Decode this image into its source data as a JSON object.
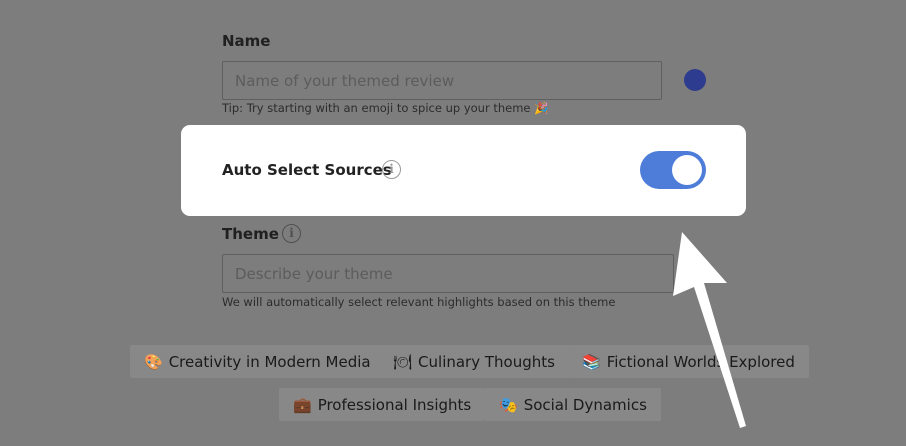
{
  "name_section": {
    "label": "Name",
    "placeholder": "Name of your themed review",
    "tip": "Tip: Try starting with an emoji to spice up your theme 🎉"
  },
  "auto_select": {
    "label": "Auto Select Sources",
    "info": "i",
    "enabled": true
  },
  "theme_section": {
    "label": "Theme",
    "info": "i",
    "placeholder": "Describe your theme",
    "tip": "We will automatically select relevant highlights based on this theme"
  },
  "suggestions": [
    {
      "emoji": "🎨",
      "label": "Creativity in Modern Media"
    },
    {
      "emoji": "🍽",
      "label": "Culinary Thoughts"
    },
    {
      "emoji": "📚",
      "label": "Fictional Worlds Explored"
    },
    {
      "emoji": "💼",
      "label": "Professional Insights"
    },
    {
      "emoji": "🎭",
      "label": "Social Dynamics"
    }
  ],
  "colors": {
    "overlay": "#7d7d7d",
    "toggle_on": "#4e7dd9",
    "dot": "#2d3c8e"
  }
}
